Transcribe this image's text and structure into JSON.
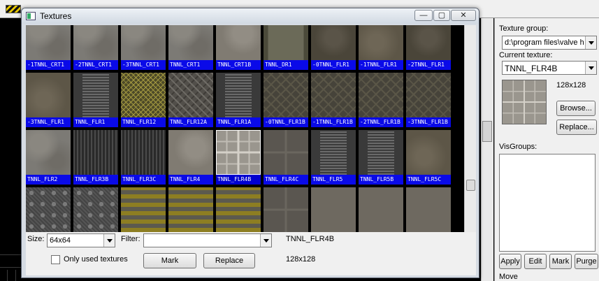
{
  "window": {
    "title": "Textures",
    "min_glyph": "—",
    "restore_glyph": "▢",
    "close_glyph": "✕"
  },
  "textures": {
    "rows": [
      [
        {
          "name": "-1TNNL_CRT1",
          "style": "t-concrete"
        },
        {
          "name": "-2TNNL_CRT1",
          "style": "t-concrete"
        },
        {
          "name": "-3TNNL_CRT1",
          "style": "t-concrete"
        },
        {
          "name": "TNNL_CRT1",
          "style": "t-concrete"
        },
        {
          "name": "TNNL_CRT1B",
          "style": "t-concrete2"
        },
        {
          "name": "TNNL_DR1",
          "style": "t-door"
        },
        {
          "name": "-0TNNL_FLR1",
          "style": "t-dark"
        },
        {
          "name": "-1TNNL_FLR1",
          "style": "t-brown"
        },
        {
          "name": "-2TNNL_FLR1",
          "style": "t-dark"
        }
      ],
      [
        {
          "name": "-3TNNL_FLR1",
          "style": "t-brown"
        },
        {
          "name": "TNNL_FLR1",
          "style": "t-grate-col"
        },
        {
          "name": "TNNL_FLR12",
          "style": "t-yellowgrid"
        },
        {
          "name": "TNNL_FLR12A",
          "style": "t-tread"
        },
        {
          "name": "TNNL_FLR1A",
          "style": "t-grate-col"
        },
        {
          "name": "-0TNNL_FLR1B",
          "style": "t-diamond"
        },
        {
          "name": "-1TNNL_FLR1B",
          "style": "t-diamond"
        },
        {
          "name": "-2TNNL_FLR1B",
          "style": "t-diamond"
        },
        {
          "name": "-3TNNL_FLR1B",
          "style": "t-diamond"
        }
      ],
      [
        {
          "name": "TNNL_FLR2",
          "style": "t-concrete"
        },
        {
          "name": "TNNL_FLR3B",
          "style": "t-grate"
        },
        {
          "name": "TNNL_FLR3C",
          "style": "t-grate"
        },
        {
          "name": "TNNL_FLR4",
          "style": "t-concrete2"
        },
        {
          "name": "TNNL_FLR4B",
          "style": "t-tile4",
          "selected": true
        },
        {
          "name": "TNNL_FLR4C",
          "style": "t-floor4c"
        },
        {
          "name": "TNNL_FLR5",
          "style": "t-grate-col"
        },
        {
          "name": "TNNL_FLR5B",
          "style": "t-grate-col"
        },
        {
          "name": "TNNL_FLR5C",
          "style": "t-brown"
        }
      ],
      [
        {
          "name": "",
          "style": "t-plate"
        },
        {
          "name": "",
          "style": "t-plate"
        },
        {
          "name": "",
          "style": "t-hazardstripe"
        },
        {
          "name": "",
          "style": "t-hazardstripe"
        },
        {
          "name": "",
          "style": "t-hazardstripe"
        },
        {
          "name": "",
          "style": "t-floor4c"
        },
        {
          "name": "",
          "style": "t-plain"
        },
        {
          "name": "",
          "style": "t-plain"
        },
        {
          "name": "",
          "style": "t-plain"
        }
      ]
    ]
  },
  "bottom": {
    "size_label": "Size:",
    "size_value": "64x64",
    "filter_label": "Filter:",
    "filter_value": "",
    "selected_name": "TNNL_FLR4B",
    "only_used_label": "Only used textures",
    "mark_label": "Mark",
    "replace_label": "Replace",
    "selected_size": "128x128"
  },
  "right_panel": {
    "texture_group_label": "Texture group:",
    "texture_group_value": "d:\\program files\\valve h",
    "current_texture_label": "Current texture:",
    "current_texture_value": "TNNL_FLR4B",
    "texture_size": "128x128",
    "browse_label": "Browse...",
    "replace_label": "Replace...",
    "visgroups_label": "VisGroups:",
    "apply_label": "Apply",
    "edit_label": "Edit",
    "mark_label": "Mark",
    "purge_label": "Purge",
    "move_label": "Move"
  }
}
